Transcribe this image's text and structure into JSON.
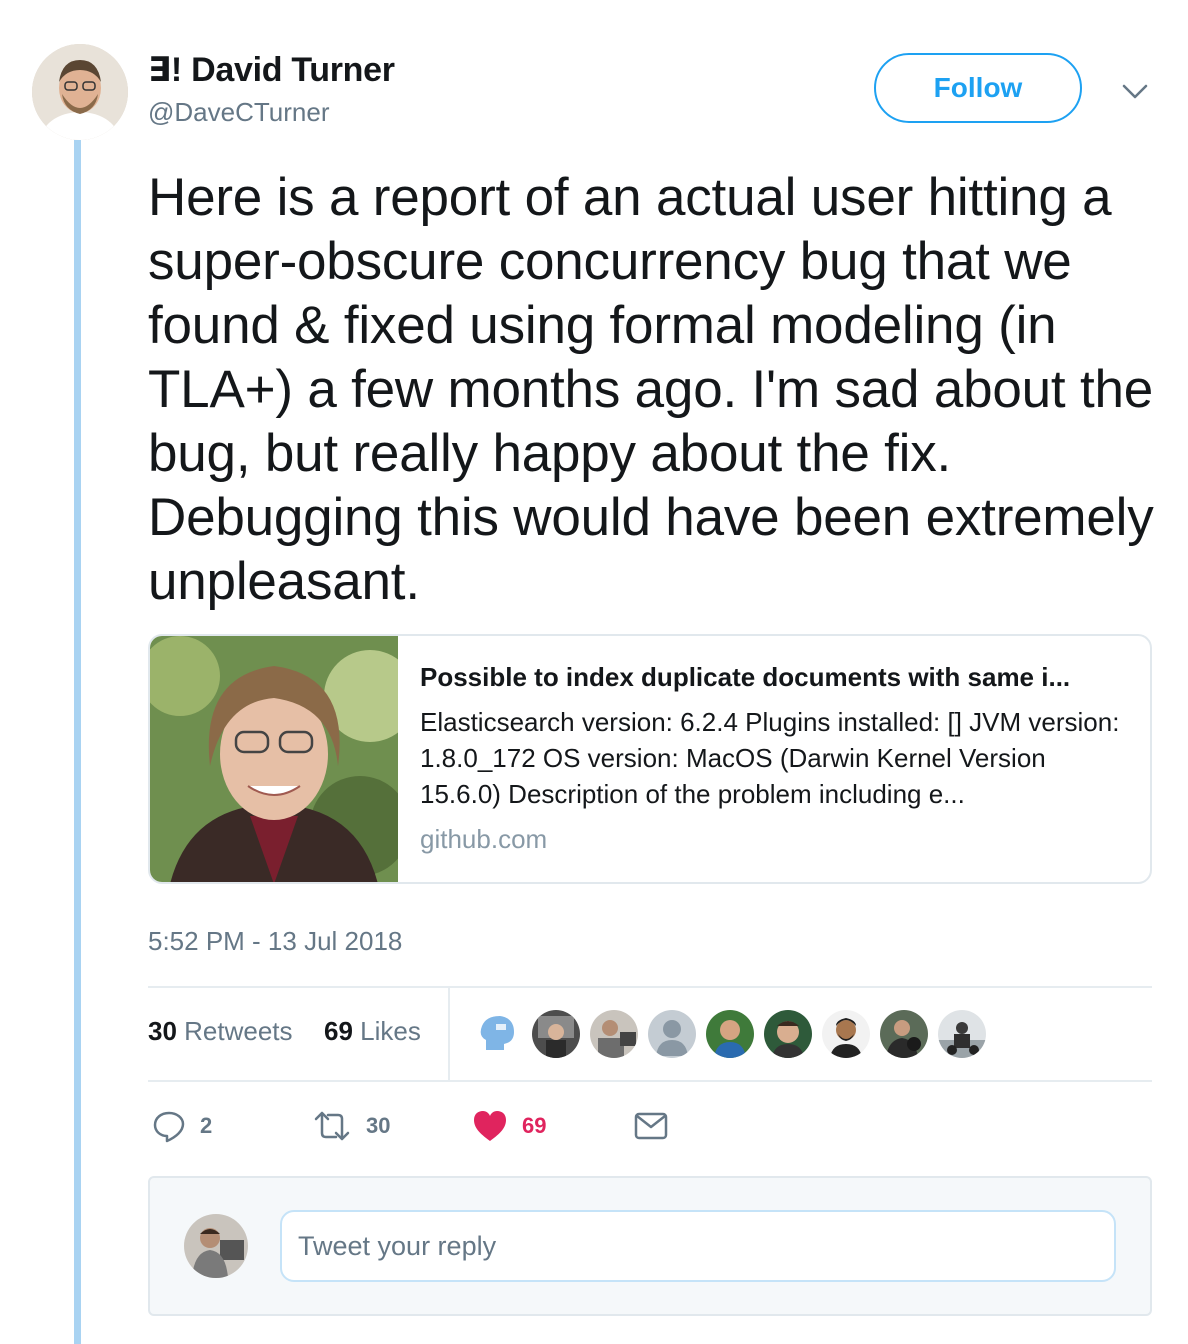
{
  "author": {
    "name": "∃! David Turner",
    "handle": "@DaveCTurner"
  },
  "follow_label": "Follow",
  "tweet": {
    "text": "Here is a report of an actual user hitting a super-obscure concurrency bug that we found & fixed using formal modeling (in TLA+) a few months ago. I'm sad about the bug, but really happy about the fix. Debugging this would have been extremely unpleasant.",
    "timestamp": "5:52 PM - 13 Jul 2018"
  },
  "card": {
    "title": "Possible to index duplicate documents with same i...",
    "description": "Elasticsearch version: 6.2.4 Plugins installed: [] JVM version: 1.8.0_172 OS version: MacOS (Darwin Kernel Version 15.6.0) Description of the problem including e...",
    "domain": "github.com"
  },
  "stats": {
    "retweets_count": "30",
    "retweets_label": " Retweets",
    "likes_count": "69",
    "likes_label": " Likes"
  },
  "actions": {
    "reply_count": "2",
    "retweet_count": "30",
    "like_count": "69"
  },
  "reply": {
    "placeholder": "Tweet your reply"
  },
  "colors": {
    "accent": "#1da1f2",
    "like_red": "#e0245e",
    "muted": "#657786",
    "thread_line": "#a9d3f2"
  }
}
